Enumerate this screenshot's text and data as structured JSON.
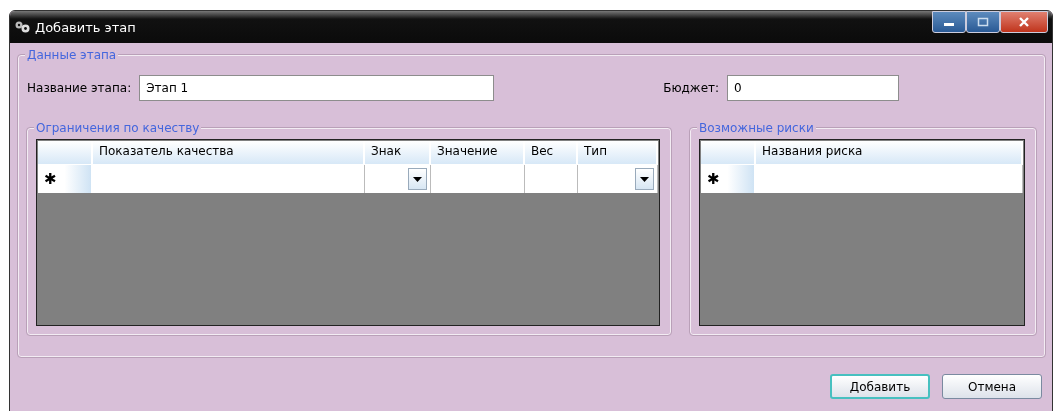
{
  "window": {
    "title": "Добавить этап"
  },
  "stage_group": {
    "title": "Данные этапа",
    "name_field": {
      "label": "Название этапа:",
      "value": "Этап 1"
    },
    "budget_field": {
      "label": "Бюджет:",
      "value": "0"
    },
    "quality_group": {
      "title": "Ограничения по качеству",
      "columns": [
        {
          "label": "Показатель качества",
          "kind": "text"
        },
        {
          "label": "Знак",
          "kind": "combo"
        },
        {
          "label": "Значение",
          "kind": "text"
        },
        {
          "label": "Вес",
          "kind": "text"
        },
        {
          "label": "Тип",
          "kind": "combo"
        }
      ],
      "new_row_marker": "✱"
    },
    "risks_group": {
      "title": "Возможные риски",
      "columns": [
        {
          "label": "Названия риска",
          "kind": "text"
        }
      ],
      "new_row_marker": "✱"
    }
  },
  "buttons": [
    {
      "label": "Добавить",
      "default": true
    },
    {
      "label": "Отмена",
      "default": false
    }
  ]
}
